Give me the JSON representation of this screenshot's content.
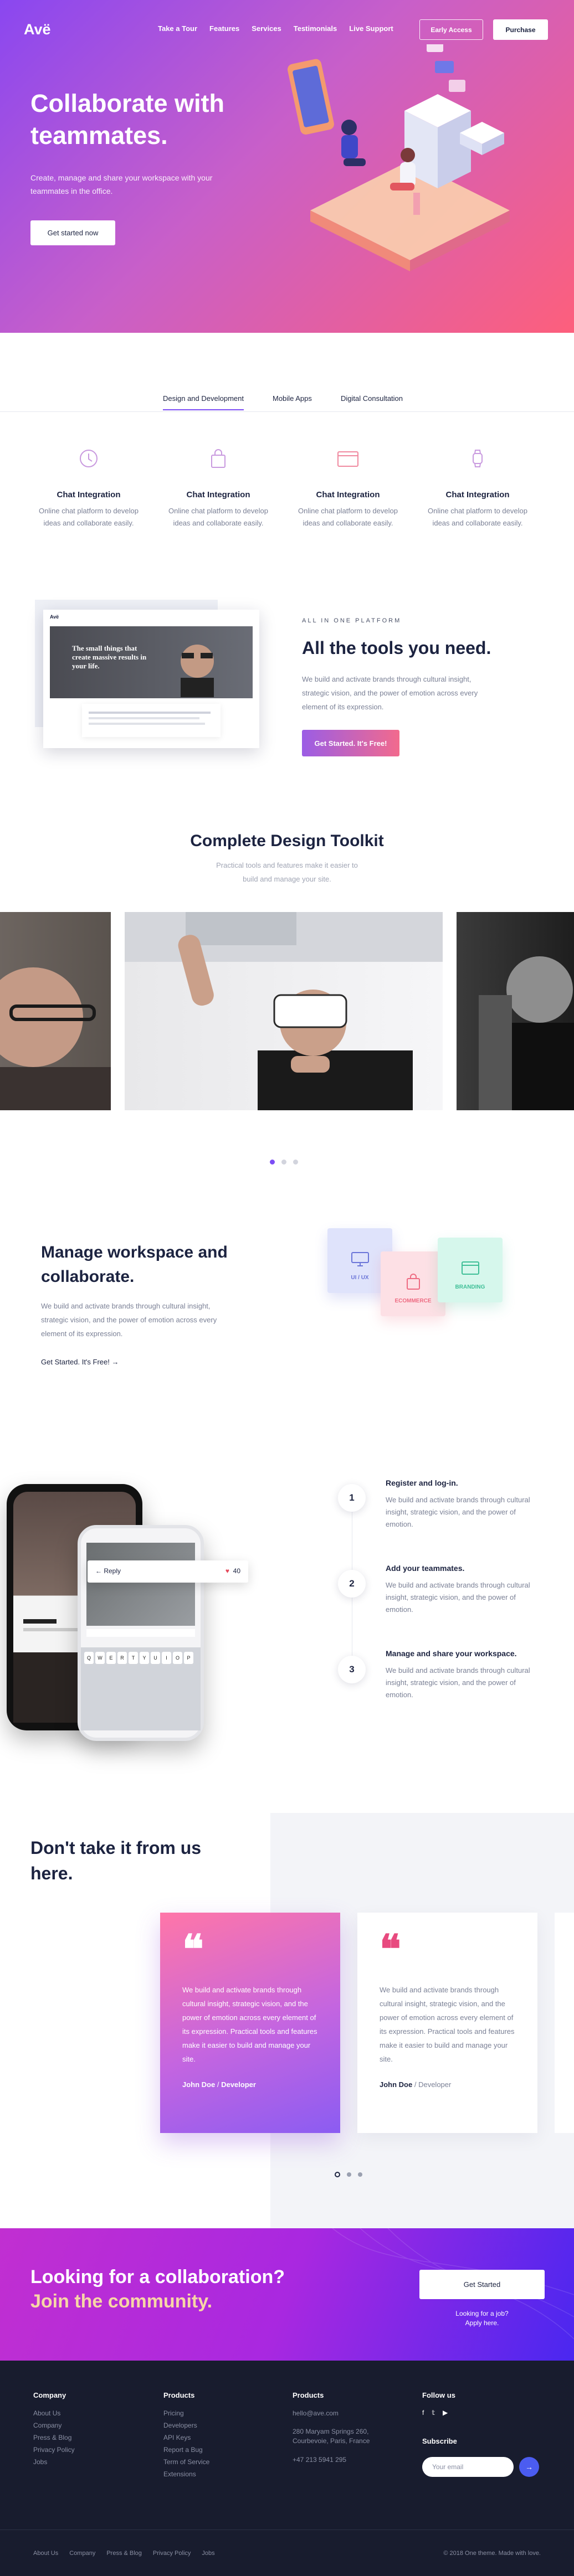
{
  "nav": {
    "logo": "Avë",
    "items": [
      "Take a Tour",
      "Features",
      "Services",
      "Testimonials",
      "Live Support"
    ],
    "early_access": "Early Access",
    "purchase": "Purchase"
  },
  "hero": {
    "title": "Collaborate with teammates.",
    "subtitle": "Create, manage and share your workspace with your teammates in the office.",
    "cta": "Get started now"
  },
  "tabs": [
    "Design and Development",
    "Mobile Apps",
    "Digital Consultation"
  ],
  "features": [
    {
      "icon": "clock-icon",
      "title": "Chat Integration",
      "text": "Online chat platform to develop ideas and collaborate easily."
    },
    {
      "icon": "shopping-bag-icon",
      "title": "Chat Integration",
      "text": "Online chat platform to develop ideas and collaborate easily."
    },
    {
      "icon": "browser-window-icon",
      "title": "Chat Integration",
      "text": "Online chat platform to develop ideas and collaborate easily."
    },
    {
      "icon": "watch-icon",
      "title": "Chat Integration",
      "text": "Online chat platform to develop ideas and collaborate easily."
    }
  ],
  "tools": {
    "kicker": "ALL IN ONE PLATFORM",
    "title": "All the tools you need.",
    "text": "We build and activate brands through cultural insight, strategic vision, and the power of emotion across every element of its expression.",
    "cta": "Get Started. It's Free!",
    "mock_brand": "Avë",
    "mock_headline": "The small things that create massive results in your life."
  },
  "toolkit": {
    "title": "Complete Design Toolkit",
    "text": "Practical tools and features make it easier to build and manage your site."
  },
  "workspace": {
    "title": "Manage workspace and collaborate.",
    "text": "We build and activate brands through cultural insight, strategic vision, and the power of emotion across every element of its expression.",
    "link": "Get Started. It's Free!",
    "tiles": [
      "UI / UX",
      "ECOMMERCE",
      "BRANDING"
    ]
  },
  "steps": [
    {
      "n": "1",
      "title": "Register and log-in.",
      "text": "We build and activate brands through cultural insight, strategic vision, and the power of emotion."
    },
    {
      "n": "2",
      "title": "Add your teammates.",
      "text": "We build and activate brands through cultural insight, strategic vision, and the power of emotion."
    },
    {
      "n": "3",
      "title": "Manage and share your workspace.",
      "text": "We build and activate brands through cultural insight, strategic vision, and the power of emotion."
    }
  ],
  "phone": {
    "reply": "Reply",
    "likes": "40",
    "keys": [
      "Q",
      "W",
      "E",
      "R",
      "T",
      "Y",
      "U",
      "I",
      "O",
      "P"
    ]
  },
  "testimonials": {
    "title": "Don't take it from us here.",
    "cards": [
      {
        "text": "We build and activate brands through cultural insight, strategic vision, and the power of emotion across every element of its expression. Practical tools and features make it easier to build and manage your site.",
        "author": "John Doe",
        "role": "Developer"
      },
      {
        "text": "We build and activate brands through cultural insight, strategic vision, and the power of emotion across every element of its expression. Practical tools and features make it easier to build and manage your site.",
        "author": "John Doe",
        "role": "Developer"
      }
    ]
  },
  "cta": {
    "line1": "Looking for a collaboration?",
    "line2": "Join the community.",
    "button": "Get Started",
    "small1": "Looking for a job?",
    "small2": "Apply here."
  },
  "footer": {
    "company": {
      "title": "Company",
      "links": [
        "About Us",
        "Company",
        "Press & Blog",
        "Privacy Policy",
        "Jobs"
      ]
    },
    "products": {
      "title": "Products",
      "links": [
        "Pricing",
        "Developers",
        "API Keys",
        "Report a Bug",
        "Term of Service",
        "Extensions"
      ]
    },
    "contact": {
      "title": "Products",
      "email": "hello@ave.com",
      "address": "280 Maryam Springs 260, Courbevoie, Paris, France",
      "phone": "+47 213 5941 295"
    },
    "follow": {
      "title": "Follow us",
      "subscribe": "Subscribe",
      "placeholder": "Your email"
    },
    "bottom_links": [
      "About Us",
      "Company",
      "Press & Blog",
      "Privacy Policy",
      "Jobs"
    ],
    "copyright": "© 2018 One theme. Made with love."
  },
  "colors": {
    "accent": "#7c4df5",
    "hero_start": "#8a47f0",
    "hero_end": "#fd5f7c",
    "footer": "#181c2e"
  }
}
